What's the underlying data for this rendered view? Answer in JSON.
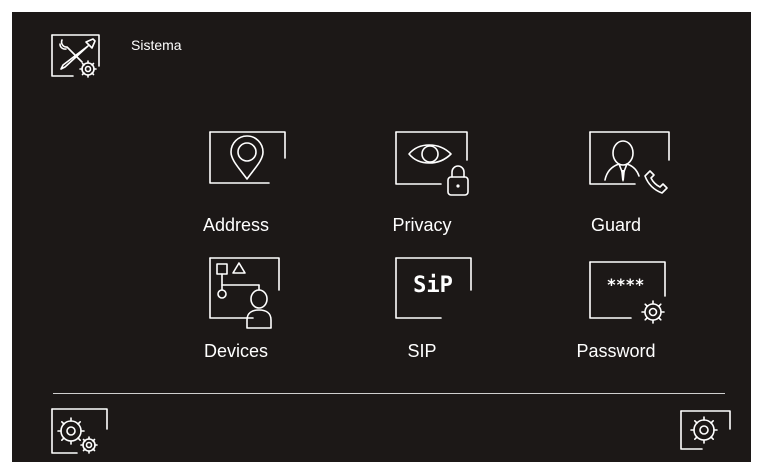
{
  "header": {
    "title": "Sistema",
    "icon": "tools-settings-icon"
  },
  "menu": {
    "items": [
      {
        "label": "Address",
        "icon": "location-pin-icon"
      },
      {
        "label": "Privacy",
        "icon": "eye-lock-icon"
      },
      {
        "label": "Guard",
        "icon": "guard-phone-icon"
      },
      {
        "label": "Devices",
        "icon": "device-tree-icon"
      },
      {
        "label": "SIP",
        "icon": "sip-icon"
      },
      {
        "label": "Password",
        "icon": "password-gear-icon"
      }
    ]
  },
  "sip_icon_text": "SiP",
  "password_mask": "****",
  "footer": {
    "left_icon": "double-gear-icon",
    "right_icon": "gear-icon"
  },
  "colors": {
    "background": "#1c1817",
    "foreground": "#ffffff",
    "divider": "#cfcfcf"
  }
}
